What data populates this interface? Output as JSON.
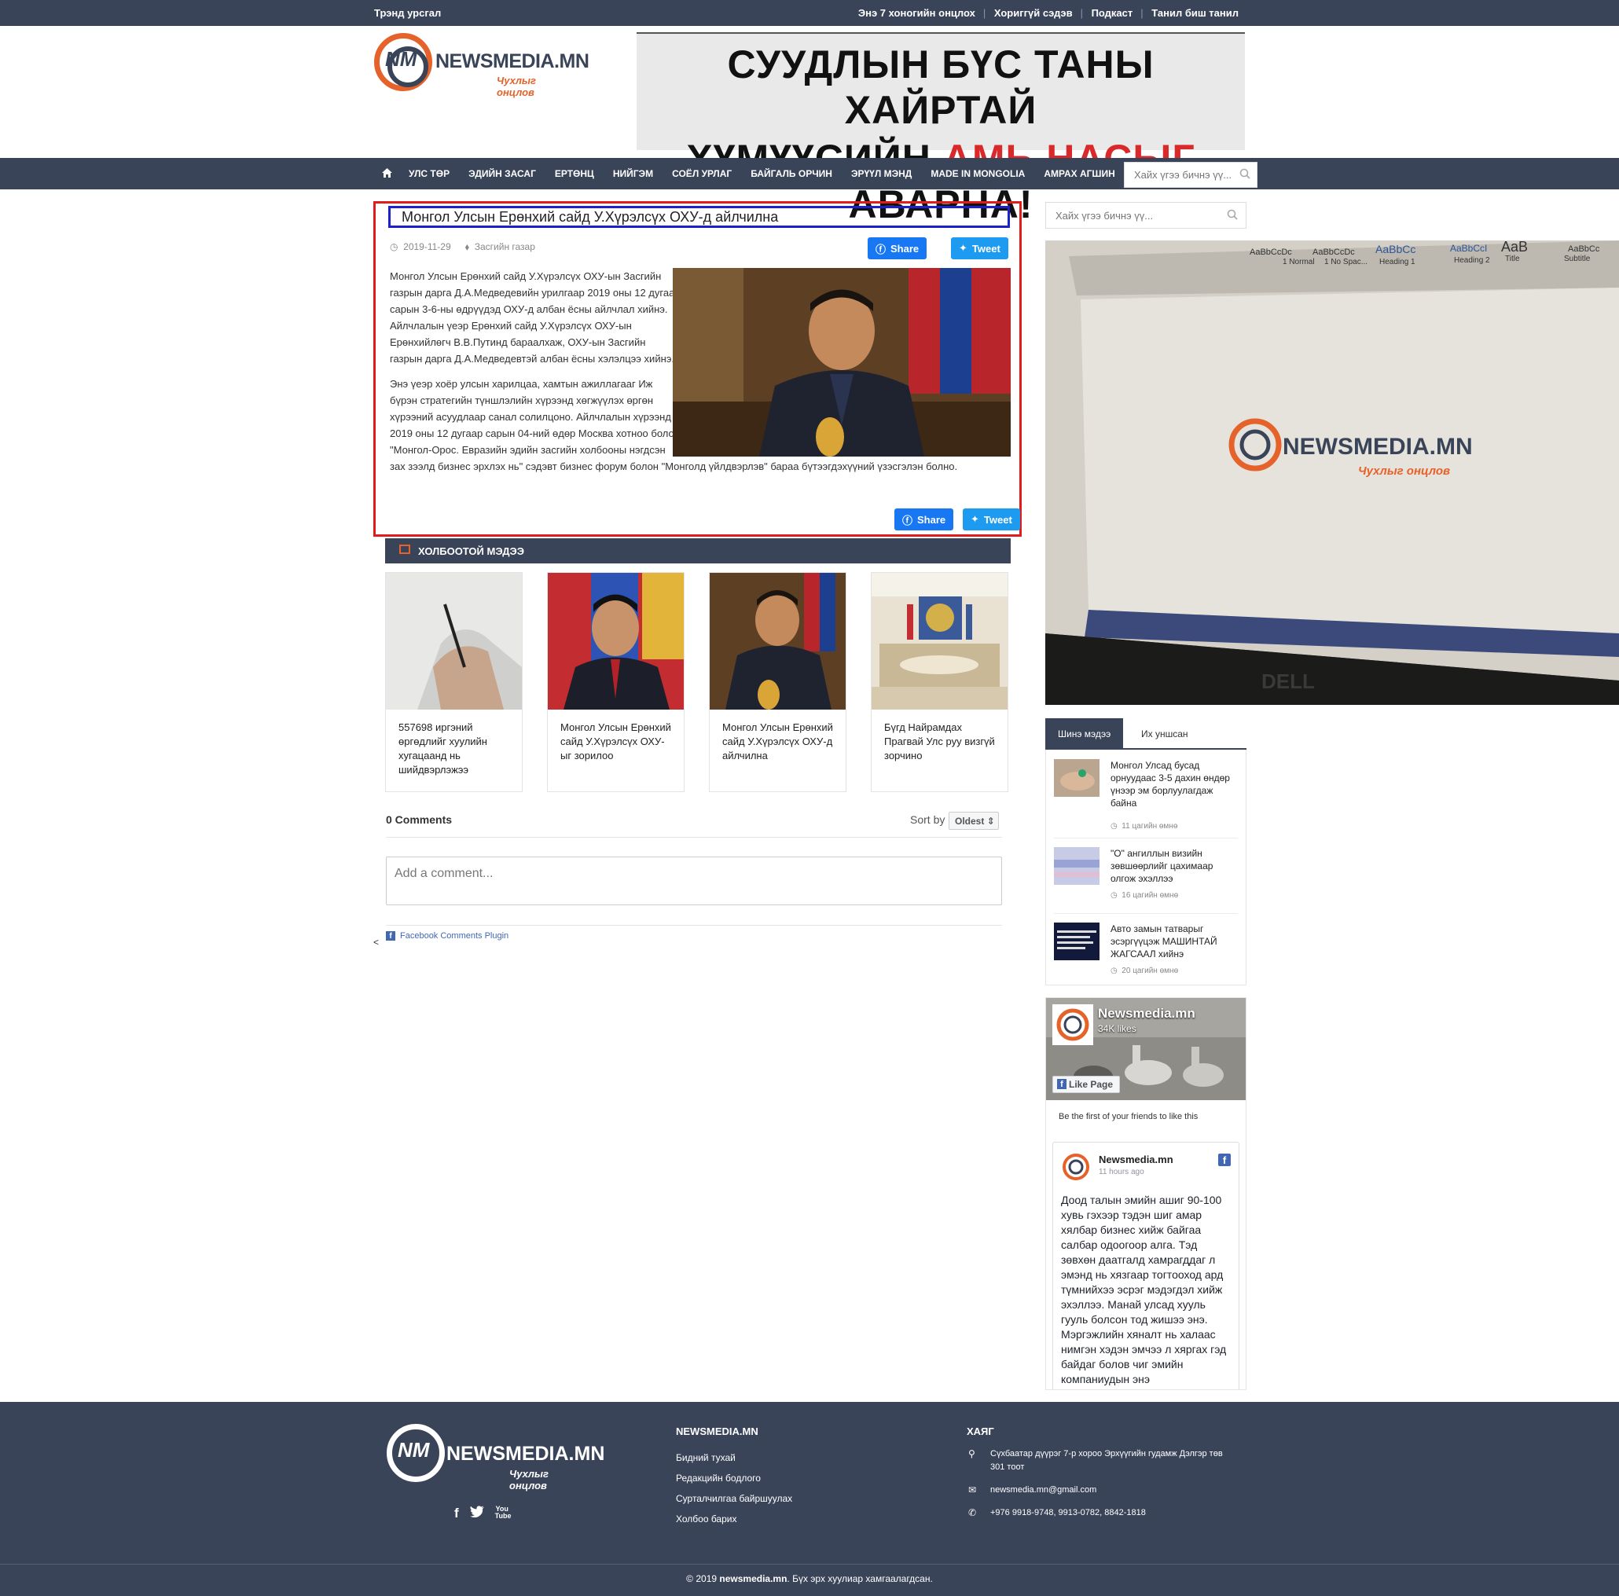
{
  "topbar": {
    "trend": "Трэнд урсгал",
    "links": [
      "Энэ 7 хоногийн онцлох",
      "Хориггүй сэдэв",
      "Подкаст",
      "Танил биш танил"
    ]
  },
  "logo": {
    "brand": "NEWSMEDIA.MN",
    "tagline": "Чухлыг онцлов",
    "mark": "NM"
  },
  "banner": {
    "line1": "СУУДЛЫН БҮС ТАНЫ ХАЙРТАЙ",
    "line2_a": "ХҮМҮҮСИЙН ",
    "line2_red": "АМЬ НАСЫГ",
    "line2_b": " АВАРНА!",
    "accent_color": "#d9292a"
  },
  "nav": {
    "home_icon": "home-icon",
    "items": [
      "УЛС ТӨР",
      "ЭДИЙН ЗАСАГ",
      "ЕРТӨНЦ",
      "НИЙГЭМ",
      "СОЁЛ УРЛАГ",
      "БАЙГАЛЬ ОРЧИН",
      "ЭРҮҮЛ МЭНД",
      "MADE IN MONGOLIA",
      "АМРАХ АГШИН"
    ],
    "search_placeholder": "Хайх үгээ бичнэ үү..."
  },
  "article": {
    "title": "Монгол Улсын Ерөнхий сайд У.Хүрэлсүх ОХУ-д айлчилна",
    "date": "2019-11-29",
    "category": "Засгийн газар",
    "share_label": "Share",
    "tweet_label": "Tweet",
    "paragraph1": "Монгол Улсын Ерөнхий сайд У.Хүрэлсүх ОХУ-ын Засгийн газрын дарга Д.А.Медведевийн урилгаар 2019 оны 12 дугаар сарын 3-6-ны өдрүүдэд ОХУ-д албан ёсны айлчлал хийнэ. Айлчлалын үеэр Ерөнхий сайд У.Хүрэлсүх ОХУ-ын Ерөнхийлөгч В.В.Путинд бараалхаж, ОХУ-ын Засгийн газрын дарга Д.А.Медведевтэй албан ёсны хэлэлцээ хийнэ.",
    "paragraph2": "Энэ үеэр хоёр улсын харилцаа, хамтын ажиллагааг Иж бүрэн стратегийн түншлэлийн хүрээнд хөгжүүлэх өргөн хүрээний асуудлаар санал солилцоно. Айлчлалын хүрээнд 2019 оны 12 дугаар сарын 04-ний өдөр Москва хотноо болох \"Монгол-Орос. Евразийн эдийн засгийн холбооны нэгдсэн зах зээлд бизнес эрхлэх нь\" сэдэвт бизнес форум болон \"Монголд үйлдвэрлэв\" бараа бүтээгдэхүүний үзэсгэлэн болно."
  },
  "related": {
    "heading": "ХОЛБООТОЙ МЭДЭЭ",
    "items": [
      {
        "title": "557698 иргэний өргөдлийг хуулийн хугацаанд нь шийдвэрлэжээ"
      },
      {
        "title": "Монгол Улсын Ерөнхий сайд У.Хүрэлсүх ОХУ-ыг зорилоо"
      },
      {
        "title": "Монгол Улсын Ерөнхий сайд У.Хүрэлсүх ОХУ-д айлчилна"
      },
      {
        "title": "Бүгд Найрамдах Прагвай Улс руу визгүй зорчино"
      }
    ]
  },
  "comments": {
    "count": "0 Comments",
    "sort_label": "Sort by",
    "sort_value": "Oldest",
    "placeholder": "Add a comment...",
    "plugin": "Facebook Comments Plugin",
    "back": "<"
  },
  "sidebar": {
    "search_placeholder": "Хайх үгээ бичнэ үү...",
    "ad_brand": "NEWSMEDIA.MN",
    "ad_tagline": "Чухлыг онцлов",
    "ribbon": [
      "AaBbCcDc",
      "AaBbCcDc",
      "AaBbCc",
      "AaBbCcI",
      "AaB",
      "AaBbCc"
    ],
    "ribbon_styles": [
      "1 Normal",
      "1 No Spac...",
      "Heading 1",
      "Heading 2",
      "Title",
      "Subtitle"
    ],
    "monitor": "DELL",
    "tabs": [
      "Шинэ мэдээ",
      "Их уншсан"
    ],
    "news": [
      {
        "title": "Монгол Улсад бусад орнуудаас 3-5 дахин өндөр үнээр эм борлуулагдаж байна",
        "time": "11 цагийн өмнө"
      },
      {
        "title": "\"О\" ангиллын визийн зөвшөөрлийг цахимаар олгож эхэллээ",
        "time": "16 цагийн өмнө"
      },
      {
        "title": "Авто замын татварыг эсэргүүцэж МАШИНТАЙ ЖАГСААЛ хийнэ",
        "time": "20 цагийн өмнө"
      }
    ]
  },
  "fb_widget": {
    "page_name": "Newsmedia.mn",
    "likes": "34K likes",
    "like_button": "Like Page",
    "friends": "Be the first of your friends to like this",
    "post_author": "Newsmedia.mn",
    "post_time": "11 hours ago",
    "post_text": "Доод талын эмийн ашиг 90-100 хувь гэхээр тэдэн шиг амар хялбар бизнес хийж байгаа салбар одоогоор алга. Тэд зөвхөн даатгалд хамрагддаг л эмэнд нь хязгаар тогтооход ард түмнийхээ эсрэг мэдэгдэл хийж эхэллээ. Манай улсад хууль гууль болсон тод жишээ энэ. Мэргэжлийн хяналт нь халаас нимгэн хэдэн эмчээ л хяргах гэд байдаг болов чиг эмийн компаниудын энэ"
  },
  "footer": {
    "brand": "NEWSMEDIA.MN",
    "tagline": "Чухлыг онцлов",
    "col1_title": "NEWSMEDIA.MN",
    "col1_links": [
      "Бидний тухай",
      "Редакцийн бодлого",
      "Сурталчилгаа байршуулах",
      "Холбоо барих"
    ],
    "col2_title": "ХАЯГ",
    "address": "Сүхбаатар дүүрэг 7-р хороо Эрхүүгийн гудамж Дэлгэр төв 301 тоот",
    "email": "newsmedia.mn@gmail.com",
    "phone": "+976 9918-9748, 9913-0782, 8842-1818",
    "copy_prefix": "© 2019 ",
    "copy_brand": "newsmedia.mn",
    "copy_suffix": ". Бүх эрх хуулиар хамгаалагдсан.",
    "social": [
      "f",
      "t",
      "You Tube"
    ]
  },
  "colors": {
    "navy": "#3a4459",
    "orange": "#e5622a",
    "facebook": "#1877f2",
    "twitter": "#1d9bf0",
    "highlight_red": "#e21b1b",
    "highlight_blue": "#1b22c9"
  }
}
